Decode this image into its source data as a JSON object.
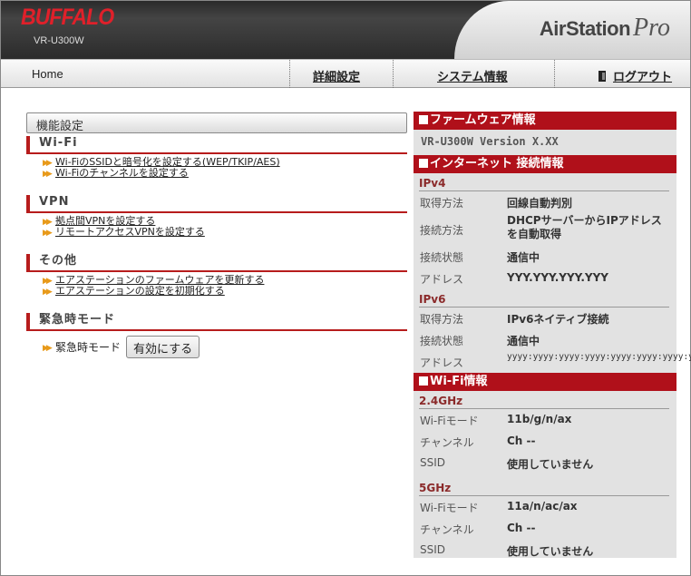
{
  "header": {
    "logo_text": "BUFFALO",
    "model": "VR-U300W",
    "brand_part1": "AirStation",
    "brand_part2": "Pro"
  },
  "nav": {
    "home": "Home",
    "advanced": "詳細設定",
    "system_info": "システム情報",
    "logout": "ログアウト"
  },
  "left": {
    "panel_title": "機能設定",
    "wifi": {
      "title": "Wi-Fi",
      "links": [
        "Wi-FiのSSIDと暗号化を設定する(WEP/TKIP/AES)",
        "Wi-Fiのチャンネルを設定する"
      ]
    },
    "vpn": {
      "title": "VPN",
      "links": [
        "拠点間VPNを設定する",
        "リモートアクセスVPNを設定する"
      ]
    },
    "other": {
      "title": "その他",
      "links": [
        "エアステーションのファームウェアを更新する",
        "エアステーションの設定を初期化する"
      ]
    },
    "emergency": {
      "title": "緊急時モード",
      "label": "緊急時モード",
      "button": "有効にする"
    }
  },
  "right": {
    "firmware": {
      "title": "ファームウェア情報",
      "version": "VR-U300W Version X.XX"
    },
    "internet": {
      "title": "インターネット 接続情報",
      "ipv4": {
        "title": "IPv4",
        "rows": [
          {
            "k": "取得方法",
            "v": "回線自動判別"
          },
          {
            "k": "接続方法",
            "v": "DHCPサーバーからIPアドレスを自動取得"
          },
          {
            "k": "接続状態",
            "v": "通信中"
          },
          {
            "k": "アドレス",
            "v": "YYY.YYY.YYY.YYY"
          }
        ]
      },
      "ipv6": {
        "title": "IPv6",
        "rows": [
          {
            "k": "取得方法",
            "v": "IPv6ネイティブ接続"
          },
          {
            "k": "接続状態",
            "v": "通信中"
          },
          {
            "k": "アドレス",
            "v": "yyyy:yyyy:yyyy:yyyy:yyyy:yyyy:yyyy:yyyy/yy"
          }
        ]
      }
    },
    "wifi": {
      "title": "Wi-Fi情報",
      "g24": {
        "title": "2.4GHz",
        "rows": [
          {
            "k": "Wi-Fiモード",
            "v": "11b/g/n/ax"
          },
          {
            "k": "チャンネル",
            "v": "Ch --"
          },
          {
            "k": "SSID",
            "v": "使用していません"
          }
        ]
      },
      "g5": {
        "title": "5GHz",
        "rows": [
          {
            "k": "Wi-Fiモード",
            "v": "11a/n/ac/ax"
          },
          {
            "k": "チャンネル",
            "v": "Ch --"
          },
          {
            "k": "SSID",
            "v": "使用していません"
          }
        ]
      }
    }
  }
}
